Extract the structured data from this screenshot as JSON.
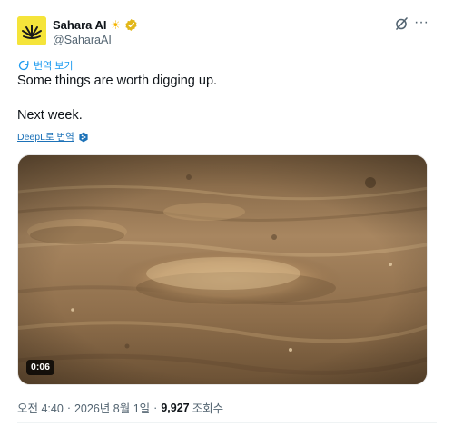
{
  "author": {
    "display_name": "Sahara AI",
    "handle": "@SaharaAI",
    "badge_icon": "sun-emoji",
    "verified_color": "#e2b719",
    "avatar_bg": "#f5e43a"
  },
  "header_actions": {
    "grok_icon": "grok-icon",
    "more_label": "···"
  },
  "translate": {
    "label": "번역 보기",
    "icon": "translate-icon"
  },
  "tweet": {
    "text": "Some things are worth digging up.\n\nNext week."
  },
  "deepl": {
    "label": "DeepL로 번역",
    "icon": "deepl-icon"
  },
  "media": {
    "type": "video",
    "duration": "0:06"
  },
  "meta": {
    "time": "오전 4:40",
    "separator": "·",
    "date": "2026년 8월 1일",
    "separator2": "·",
    "views": "9,927",
    "views_label": "조회수"
  },
  "colors": {
    "accent": "#1d9bf0",
    "text": "#0f1419",
    "muted": "#536471"
  }
}
